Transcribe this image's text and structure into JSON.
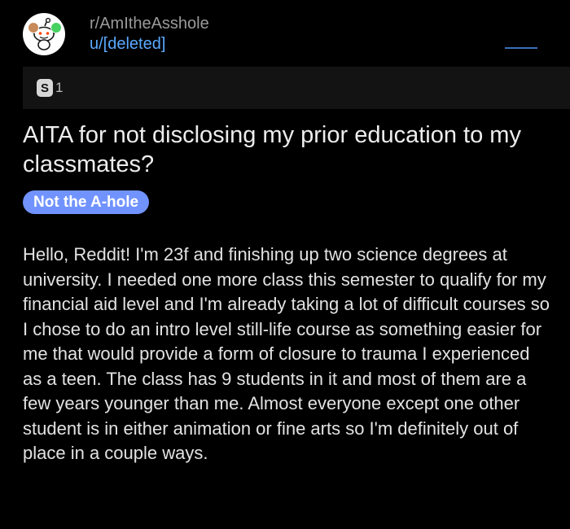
{
  "header": {
    "subreddit": "r/AmItheAsshole",
    "author": "u/[deleted]",
    "avatar_icon": "reddit-snoo-icon"
  },
  "awards": {
    "icon": "silver-award-icon",
    "count": "1"
  },
  "post": {
    "title": "AITA for not disclosing my prior education to my classmates?",
    "flair": "Not the A-hole",
    "body": "Hello, Reddit! I'm 23f and finishing up two science degrees at university. I needed one more class this semester to qualify for my financial aid level and I'm already taking a lot of difficult courses so I chose to do an intro level still-life course as something easier for me that would provide a form of closure to trauma I experienced as a teen. The class has 9 students in it and most of them are a few years younger than me. Almost everyone except one other student is in either animation or fine arts so I'm definitely out of place in a couple ways."
  },
  "colors": {
    "background": "#000000",
    "flair_bg": "#7193ff",
    "author": "#5aa9ff",
    "subreddit": "#9a9a9a",
    "awards_bar": "#131313"
  }
}
